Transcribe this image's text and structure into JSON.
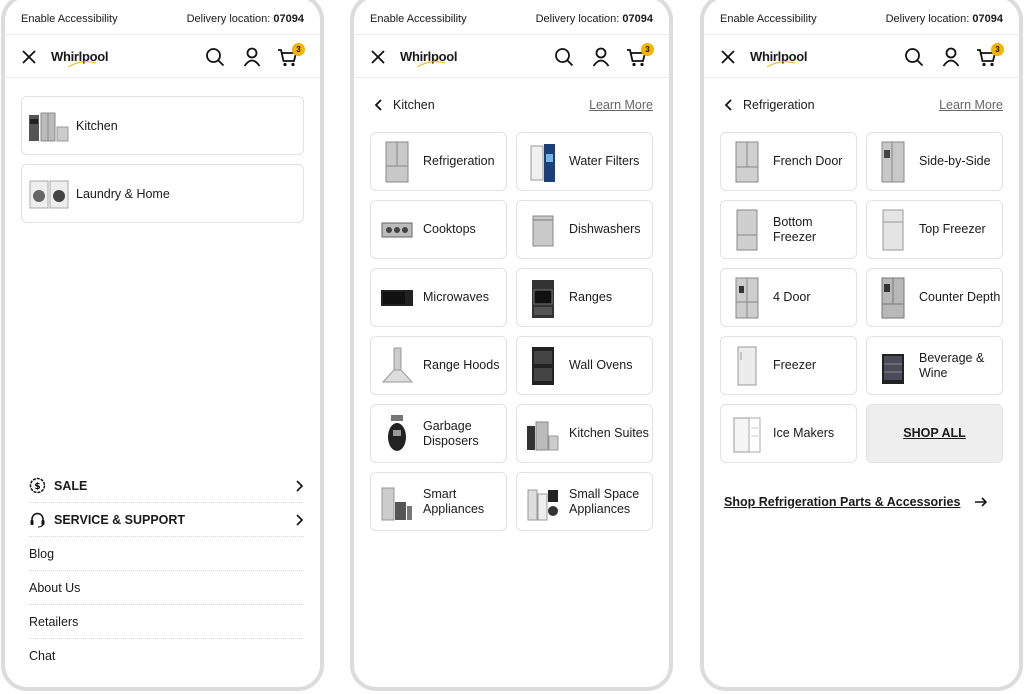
{
  "topbar": {
    "accessibility": "Enable Accessibility",
    "delivery_label": "Delivery location:",
    "zip": "07094"
  },
  "header": {
    "logo": "Whirlpool",
    "cart_count": "3"
  },
  "colors": {
    "badge": "#f4b400",
    "border": "#e2e2e2",
    "shop_all_bg": "#eeeeee"
  },
  "panel1": {
    "categories": [
      {
        "label": "Kitchen",
        "icon": "kitchen-appliances-icon"
      },
      {
        "label": "Laundry & Home",
        "icon": "laundry-icon"
      }
    ],
    "links": [
      {
        "label": "SALE",
        "icon": "sale-tag-icon",
        "bold": true
      },
      {
        "label": "SERVICE & SUPPORT",
        "icon": "headset-icon",
        "bold": true
      },
      {
        "label": "Blog"
      },
      {
        "label": "About Us"
      },
      {
        "label": "Retailers"
      },
      {
        "label": "Chat"
      }
    ]
  },
  "panel2": {
    "title": "Kitchen",
    "learn_more": "Learn More",
    "items": [
      {
        "label": "Refrigeration",
        "icon": "refrigerator-icon"
      },
      {
        "label": "Water Filters",
        "icon": "water-filter-icon"
      },
      {
        "label": "Cooktops",
        "icon": "cooktop-icon"
      },
      {
        "label": "Dishwashers",
        "icon": "dishwasher-icon"
      },
      {
        "label": "Microwaves",
        "icon": "microwave-icon"
      },
      {
        "label": "Ranges",
        "icon": "range-icon"
      },
      {
        "label": "Range Hoods",
        "icon": "range-hood-icon"
      },
      {
        "label": "Wall Ovens",
        "icon": "wall-oven-icon"
      },
      {
        "label": "Garbage Disposers",
        "icon": "garbage-disposer-icon"
      },
      {
        "label": "Kitchen Suites",
        "icon": "kitchen-suite-icon"
      },
      {
        "label": "Smart Appliances",
        "icon": "smart-appliances-icon"
      },
      {
        "label": "Small Space Appliances",
        "icon": "small-space-appliances-icon"
      }
    ]
  },
  "panel3": {
    "title": "Refrigeration",
    "learn_more": "Learn More",
    "items": [
      {
        "label": "French Door",
        "icon": "french-door-fridge-icon"
      },
      {
        "label": "Side-by-Side",
        "icon": "side-by-side-fridge-icon"
      },
      {
        "label": "Bottom Freezer",
        "icon": "bottom-freezer-fridge-icon"
      },
      {
        "label": "Top Freezer",
        "icon": "top-freezer-fridge-icon"
      },
      {
        "label": "4 Door",
        "icon": "four-door-fridge-icon"
      },
      {
        "label": "Counter Depth",
        "icon": "counter-depth-fridge-icon"
      },
      {
        "label": "Freezer",
        "icon": "freezer-icon"
      },
      {
        "label": "Beverage & Wine",
        "icon": "wine-cooler-icon"
      },
      {
        "label": "Ice Makers",
        "icon": "ice-maker-icon"
      }
    ],
    "shop_all": "SHOP ALL",
    "parts_link": "Shop Refrigeration Parts & Accessories"
  }
}
